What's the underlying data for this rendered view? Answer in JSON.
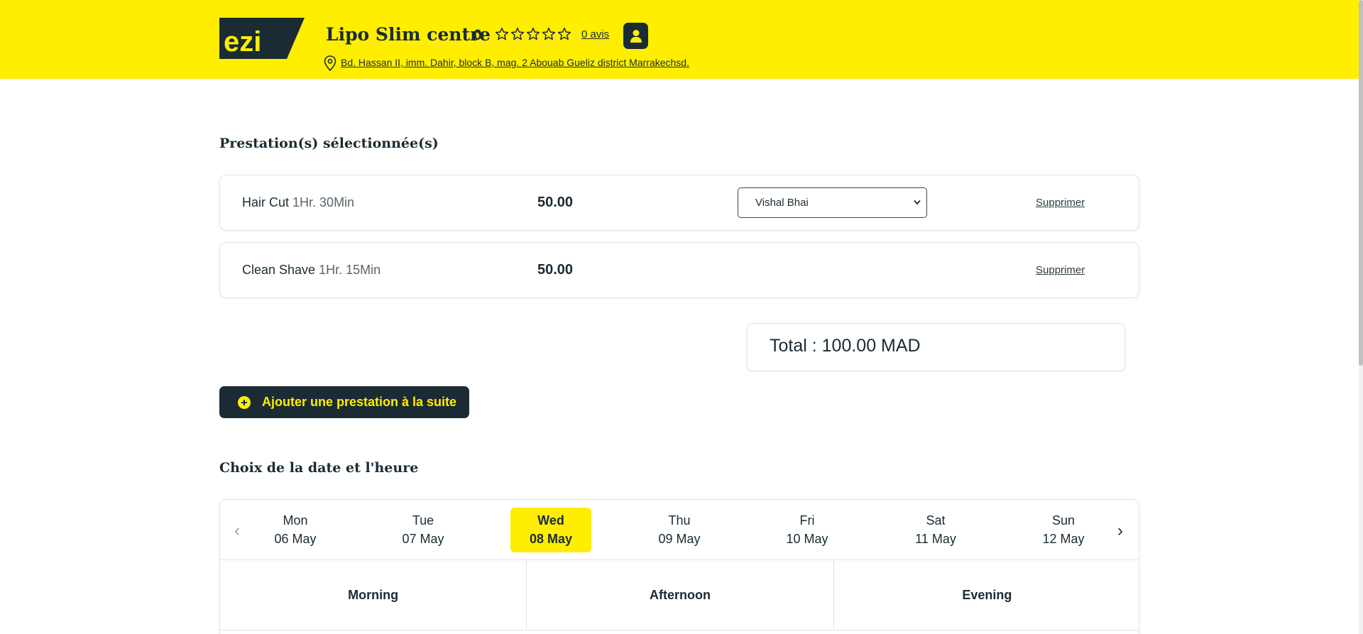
{
  "header": {
    "brand": "ezi",
    "business_name": "Lipo Slim centre",
    "rating": "0",
    "reviews_link": "0 avis",
    "address": " Bd. Hassan II, imm. Dahir, block B, mag. 2 Abouab Gueliz district Marrakechsd.",
    "colors": {
      "background": "#ffee00",
      "dark": "#1b2b33"
    },
    "icons": {
      "profile": "user-icon",
      "location": "map-pin-icon",
      "rating": "star-outline-icon"
    }
  },
  "services": {
    "title": "Prestation(s) sélectionnée(s)",
    "items": [
      {
        "name": "Hair Cut",
        "duration": "1Hr. 30Min",
        "price": "50.00",
        "staff": "Vishal Bhai",
        "remove_label": "Supprimer"
      },
      {
        "name": "Clean Shave",
        "duration": "1Hr. 15Min",
        "price": "50.00",
        "staff": "",
        "remove_label": "Supprimer"
      }
    ],
    "staff_options": [
      "Vishal Bhai"
    ],
    "total_label": "Total : 100.00 MAD"
  },
  "add_service": {
    "label": "Ajouter une prestation à la suite",
    "icon": "plus-circle-icon"
  },
  "schedule": {
    "title": "Choix de la date et l'heure",
    "days": [
      {
        "name": "Mon",
        "date": "06 May",
        "selected": false
      },
      {
        "name": "Tue",
        "date": "07 May",
        "selected": false
      },
      {
        "name": "Wed",
        "date": "08 May",
        "selected": true
      },
      {
        "name": "Thu",
        "date": "09 May",
        "selected": false
      },
      {
        "name": "Fri",
        "date": "10 May",
        "selected": false
      },
      {
        "name": "Sat",
        "date": "11 May",
        "selected": false
      },
      {
        "name": "Sun",
        "date": "12 May",
        "selected": false
      }
    ],
    "prev_arrow": "‹",
    "next_arrow": "›",
    "periods": [
      "Morning",
      "Afternoon",
      "Evening"
    ],
    "accent": "#ffee00"
  }
}
